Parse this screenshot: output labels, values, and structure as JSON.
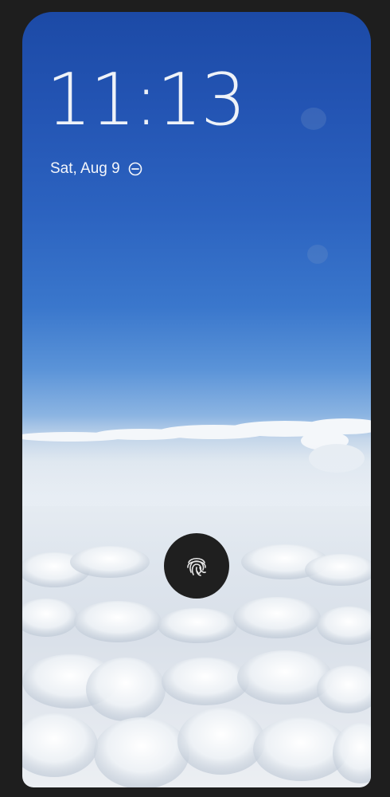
{
  "lockscreen": {
    "time": "11:13",
    "date": "Sat, Aug 9",
    "status_icon": "do-not-disturb-icon",
    "unlock_icon": "fingerprint-icon"
  },
  "colors": {
    "sky_top": "#1c4aa6",
    "sky_horizon": "#8bb4e2",
    "clouds": "#e6ecf2",
    "frame": "#1e1e1e",
    "fingerprint_bg": "#1f1f1f"
  }
}
